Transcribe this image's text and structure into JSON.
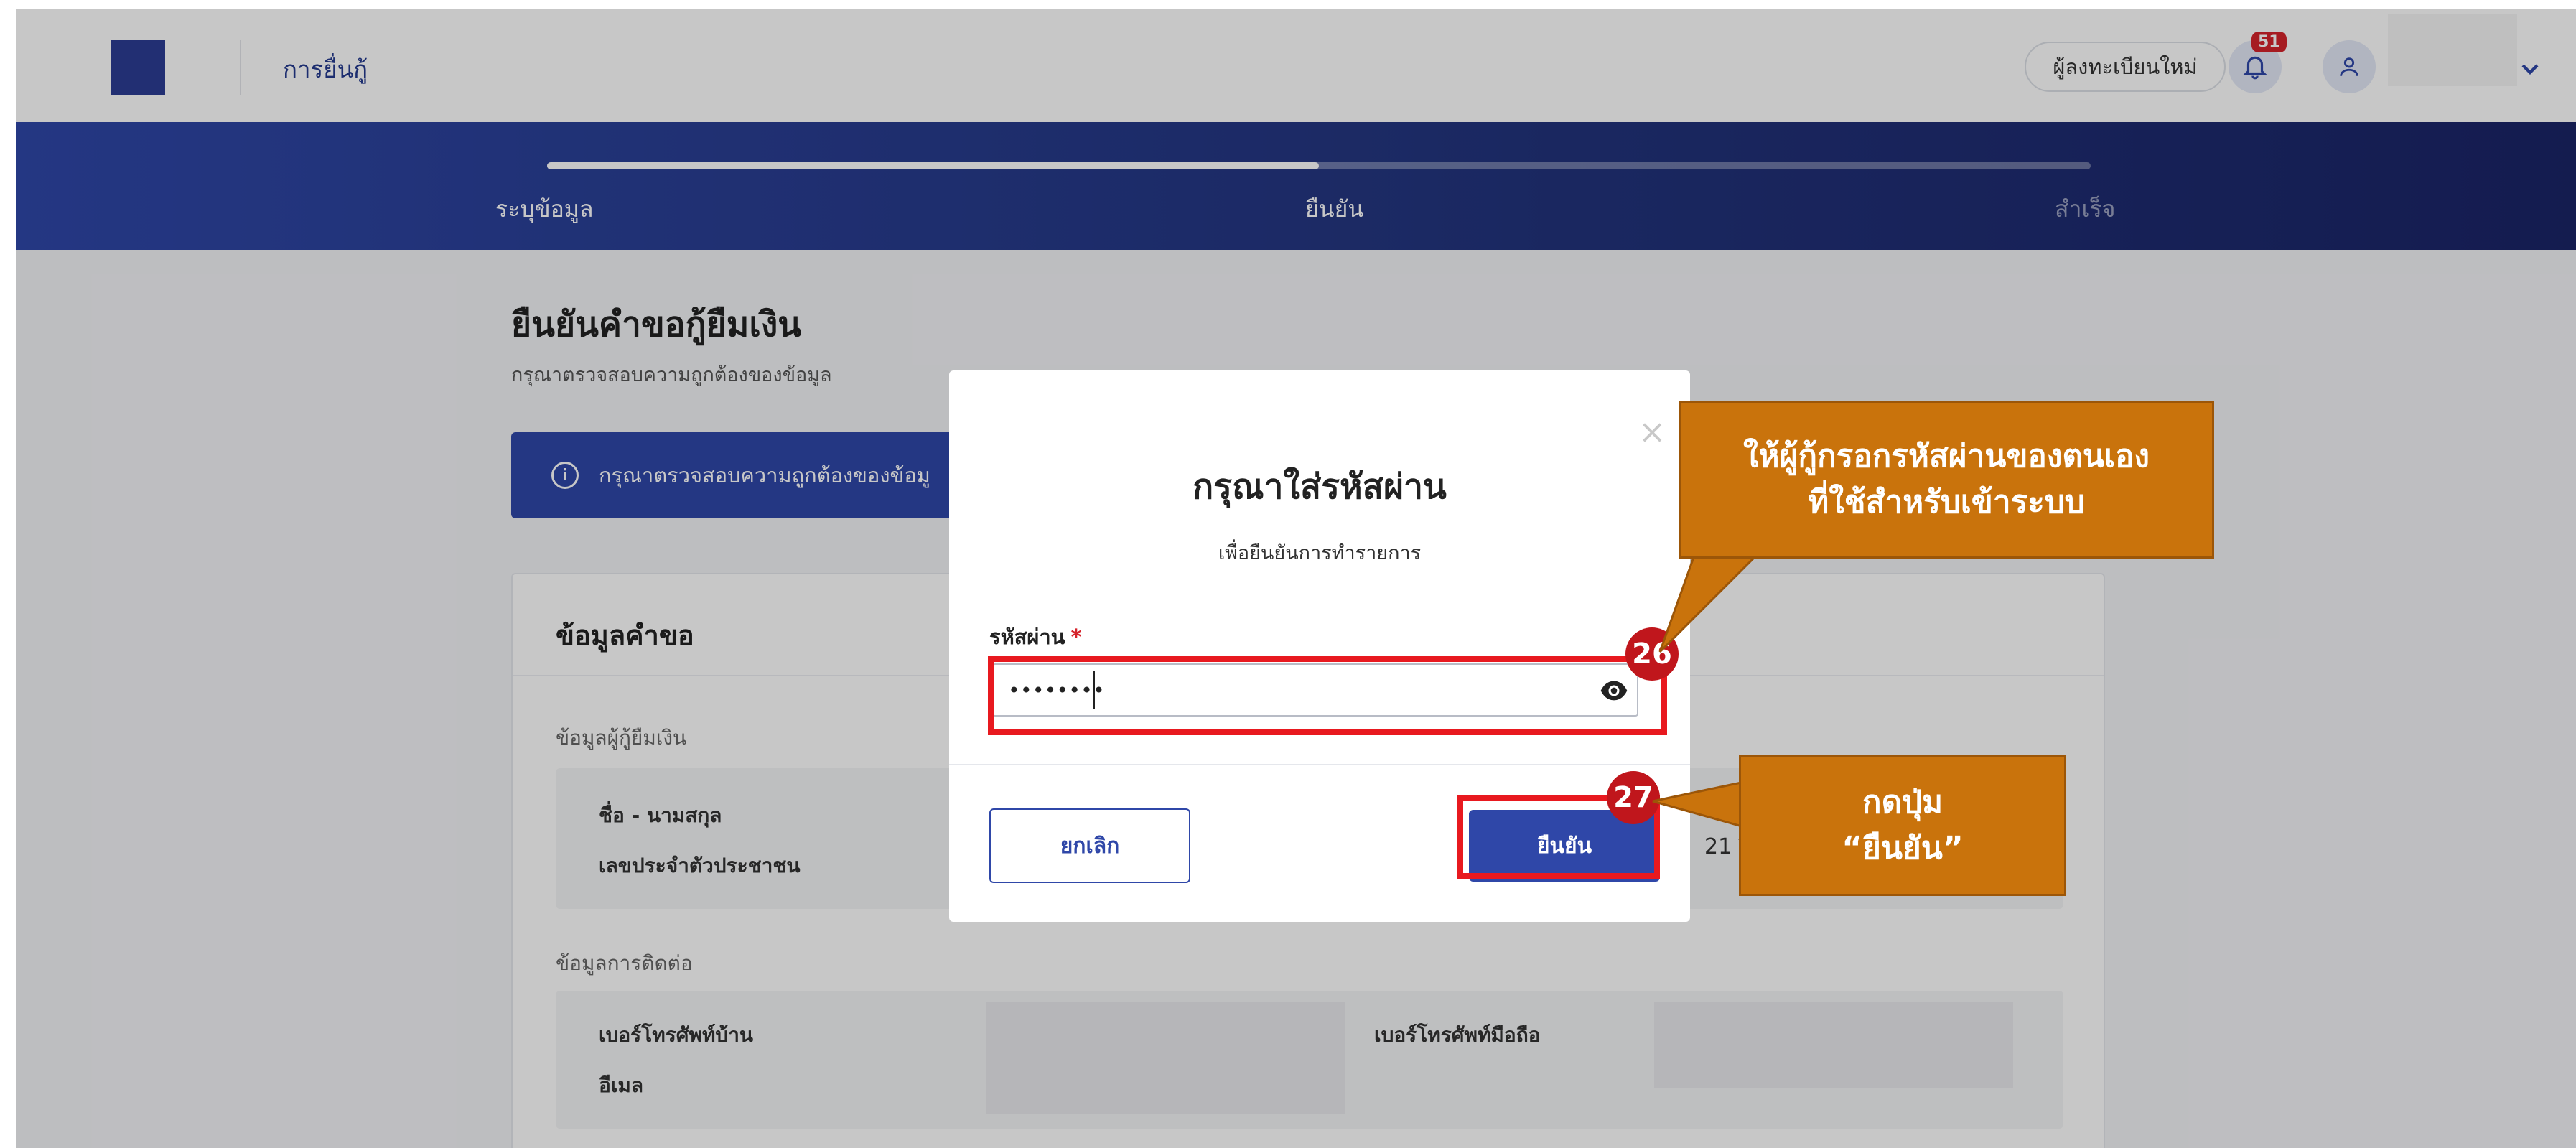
{
  "header": {
    "app_title": "การยื่นกู้",
    "register_label": "ผู้ลงทะเบียนใหม่",
    "notification_count": "51"
  },
  "stepper": {
    "steps": [
      "ระบุข้อมูล",
      "ยืนยัน",
      "สำเร็จ"
    ],
    "progress_fraction": 0.5
  },
  "page": {
    "title": "ยืนยันคำขอกู้ยืมเงิน",
    "subtitle": "กรุณาตรวจสอบความถูกต้องของข้อมูล",
    "banner_text": "กรุณาตรวจสอบความถูกต้องของข้อมู"
  },
  "card": {
    "title": "ข้อมูลคำขอ",
    "borrower_section": "ข้อมูลผู้กู้ยืมเงิน",
    "full_name_label": "ชื่อ - นามสกุล",
    "id_card_label": "เลขประจำตัวประชาชน",
    "age_fragment": "21 ปี",
    "contact_section": "ข้อมูลการติดต่อ",
    "home_phone_label": "เบอร์โทรศัพท์บ้าน",
    "mobile_phone_label": "เบอร์โทรศัพท์มือถือ",
    "email_label": "อีเมล"
  },
  "modal": {
    "title": "กรุณาใส่รหัสผ่าน",
    "subtitle": "เพื่อยืนยันการทำรายการ",
    "password_label": "รหัสผ่าน",
    "required_mark": "*",
    "password_value": "••••••••",
    "close_symbol": "×",
    "cancel_label": "ยกเลิก",
    "confirm_label": "ยืนยัน"
  },
  "annotations": {
    "step_26": "26",
    "step_27": "27",
    "callout_password_line1": "ให้ผู้กู้กรอกรหัสผ่านของตนเอง",
    "callout_password_line2": "ที่ใช้สำหรับเข้าระบบ",
    "callout_confirm_line1": "กดปุ่ม",
    "callout_confirm_line2": "“ยืนยัน”",
    "highlight_color": "#e8191f",
    "callout_color": "#c9730c"
  },
  "colors": {
    "primary": "#2f47a8",
    "badge": "#d5232b"
  }
}
